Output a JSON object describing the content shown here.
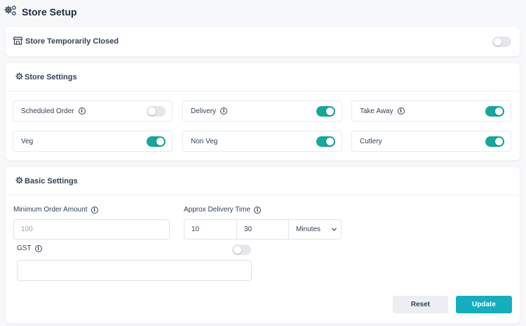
{
  "page": {
    "title": "Store Setup"
  },
  "store_closed": {
    "label": "Store Temporarily Closed",
    "enabled": false
  },
  "store_settings": {
    "title": "Store Settings",
    "options": [
      {
        "label": "Scheduled Order",
        "info": true,
        "enabled": false
      },
      {
        "label": "Delivery",
        "info": true,
        "enabled": true
      },
      {
        "label": "Take Away",
        "info": true,
        "enabled": true
      },
      {
        "label": "Veg",
        "info": false,
        "enabled": true
      },
      {
        "label": "Non Veg",
        "info": false,
        "enabled": true
      },
      {
        "label": "Cutlery",
        "info": false,
        "enabled": true
      }
    ]
  },
  "basic_settings": {
    "title": "Basic Settings",
    "min_order": {
      "label": "Minimum Order Amount",
      "placeholder": "100"
    },
    "delivery_time": {
      "label": "Approx Delivery Time",
      "min": "10",
      "max": "30",
      "unit": "Minutes",
      "unit_options": [
        "Minutes"
      ]
    },
    "gst": {
      "label": "GST",
      "enabled": false,
      "value": ""
    },
    "reset_label": "Reset",
    "update_label": "Update"
  },
  "colors": {
    "accent": "#14a89a",
    "button": "#14aebf",
    "toggle_off": "#e5e7eb",
    "text": "#334257"
  },
  "icons": {
    "page": "gears-icon",
    "store": "shop-icon",
    "section": "gear-icon",
    "info": "info-icon"
  }
}
